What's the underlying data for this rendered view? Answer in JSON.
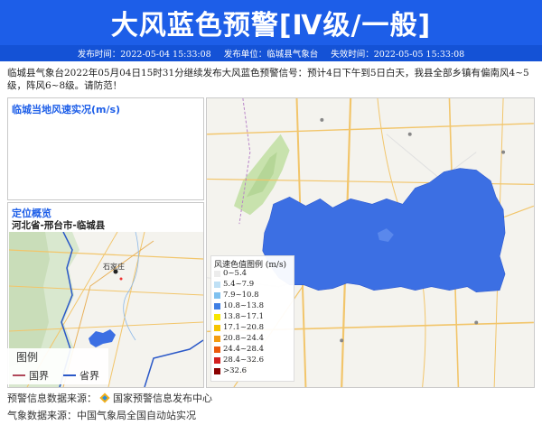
{
  "header": {
    "title": "大风蓝色预警[Ⅳ级/一般]"
  },
  "meta": {
    "publish_time": "发布时间：2022-05-04 15:33:08",
    "publisher": "发布单位：临城县气象台",
    "expire_time": "失效时间：2022-05-05 15:33:08"
  },
  "description": "临城县气象台2022年05月04日15时31分继续发布大风蓝色预警信号：预计4日下午到5日白天，我县全部乡镇有偏南风4~5级，阵风6~8级。请防范！",
  "wind_panel": {
    "title": "临城当地风速实况(m/s)"
  },
  "location_panel": {
    "title": "定位概览",
    "region": "河北省-邢台市-临城县",
    "map_labels": {
      "city": "石家庄",
      "other": "石家庄"
    }
  },
  "mini_legend": {
    "title": "图例",
    "items": [
      {
        "label": "国界",
        "color": "#b0485a"
      },
      {
        "label": "省界",
        "color": "#2a58c8"
      }
    ]
  },
  "legend": {
    "title": "风速色值图例 (m/s)",
    "items": [
      {
        "label": "0~5.4",
        "color": "#ececec"
      },
      {
        "label": "5.4~7.9",
        "color": "#bfe0f5"
      },
      {
        "label": "7.9~10.8",
        "color": "#7fc1ef"
      },
      {
        "label": "10.8~13.8",
        "color": "#3f7fe4"
      },
      {
        "label": "13.8~17.1",
        "color": "#f7e600"
      },
      {
        "label": "17.1~20.8",
        "color": "#f6c400"
      },
      {
        "label": "20.8~24.4",
        "color": "#f39c12"
      },
      {
        "label": "24.4~28.4",
        "color": "#ec5a0c"
      },
      {
        "label": "28.4~32.6",
        "color": "#d21f1f"
      },
      {
        "label": ">32.6",
        "color": "#8b0000"
      }
    ]
  },
  "sources": {
    "warning": "预警信息数据来源：",
    "warning_name": "国家预警信息发布中心",
    "weather": "气象数据来源：中国气象局全国自动站实况"
  },
  "colors": {
    "accent": "#1d5ee8",
    "warning_area": "#3c6fe3"
  }
}
